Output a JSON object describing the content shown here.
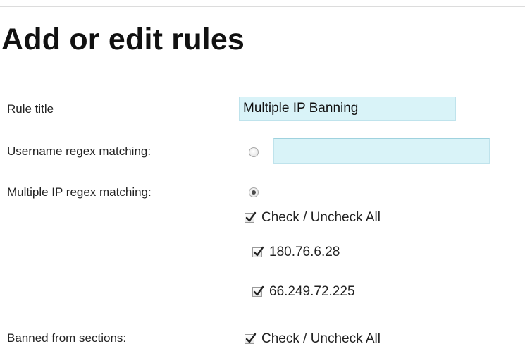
{
  "page": {
    "title": "Add or edit rules"
  },
  "form": {
    "rule_title": {
      "label": "Rule title",
      "value": "Multiple IP Banning"
    },
    "username_regex": {
      "label": "Username regex matching:",
      "selected": false,
      "value": ""
    },
    "multiple_ip_regex": {
      "label": "Multiple IP regex matching:",
      "selected": true,
      "check_all_label": "Check / Uncheck All",
      "ips": [
        {
          "value": "180.76.6.28",
          "checked": true
        },
        {
          "value": "66.249.72.225",
          "checked": true
        }
      ]
    },
    "banned_sections": {
      "label": "Banned from sections:",
      "check_all_label": "Check / Uncheck All"
    }
  }
}
